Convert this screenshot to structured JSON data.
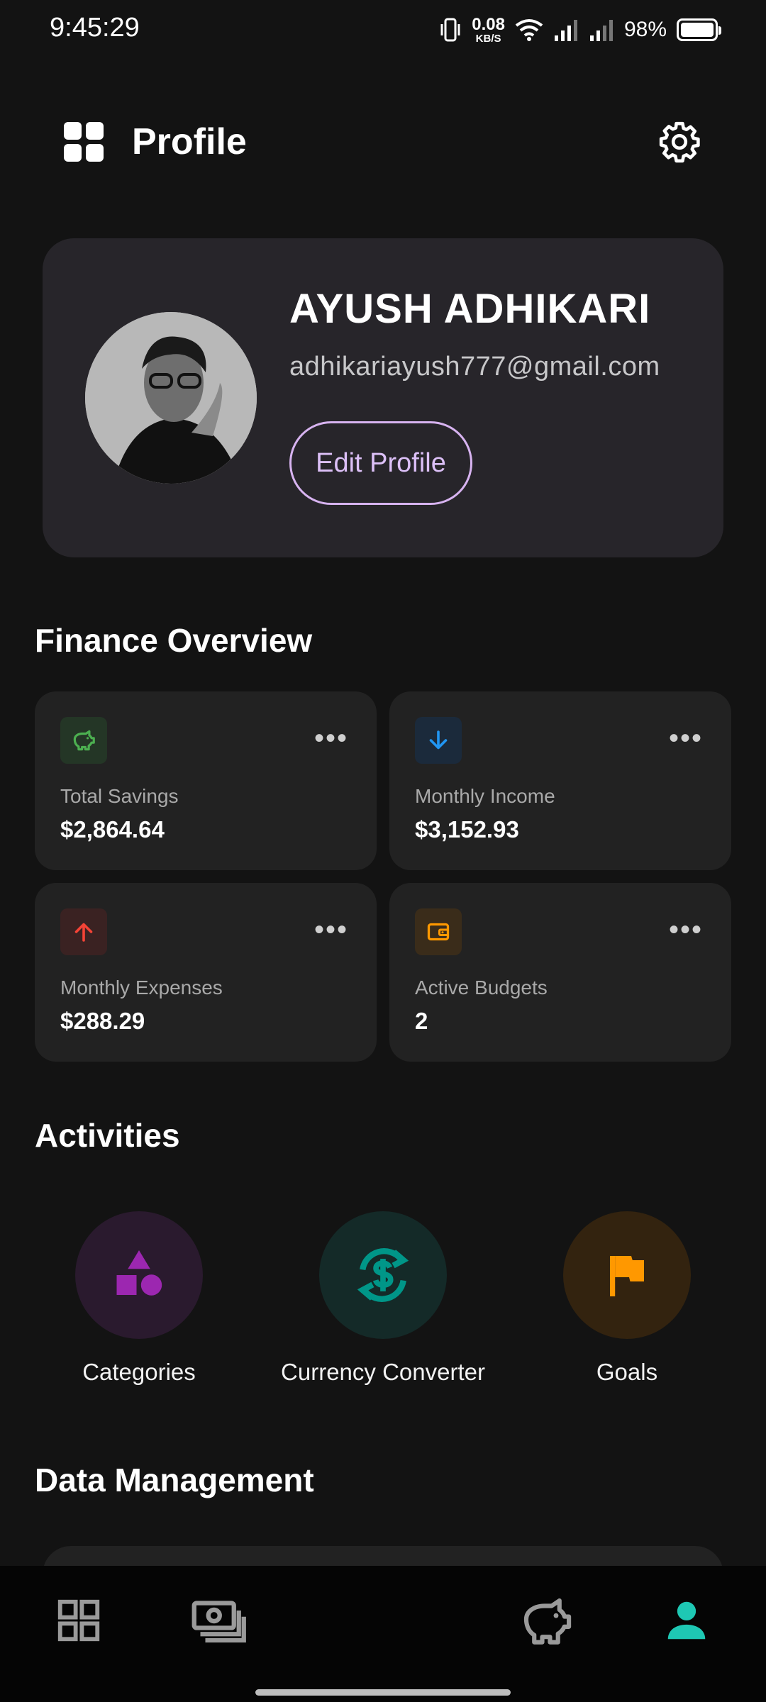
{
  "status_bar": {
    "time": "9:45:29",
    "net_speed_value": "0.08",
    "net_speed_unit": "KB/S",
    "battery": "98%"
  },
  "header": {
    "title": "Profile",
    "menu_icon": "grid-icon",
    "settings_icon": "gear-icon"
  },
  "profile": {
    "name": "AYUSH ADHIKARI",
    "email": "adhikariayush777@gmail.com",
    "edit_label": "Edit Profile"
  },
  "finance": {
    "title": "Finance Overview",
    "cards": [
      {
        "label": "Total Savings",
        "value": "$2,864.64",
        "icon": "piggy-bank-icon",
        "color": "#4caf50"
      },
      {
        "label": "Monthly Income",
        "value": "$3,152.93",
        "icon": "arrow-down-icon",
        "color": "#2196f3"
      },
      {
        "label": "Monthly Expenses",
        "value": "$288.29",
        "icon": "arrow-up-icon",
        "color": "#f44336"
      },
      {
        "label": "Active Budgets",
        "value": "2",
        "icon": "wallet-icon",
        "color": "#ff9800"
      }
    ]
  },
  "activities": {
    "title": "Activities",
    "items": [
      {
        "label": "Categories",
        "icon": "shapes-icon",
        "color": "#9c27b0"
      },
      {
        "label": "Currency Converter",
        "icon": "currency-exchange-icon",
        "color": "#009688"
      },
      {
        "label": "Goals",
        "icon": "flag-icon",
        "color": "#ff9800"
      }
    ]
  },
  "data_management": {
    "title": "Data Management"
  },
  "bottom_nav": {
    "items": [
      "dashboard-icon",
      "transactions-icon",
      "savings-icon",
      "profile-icon"
    ],
    "active_color": "#1ec8b4"
  }
}
